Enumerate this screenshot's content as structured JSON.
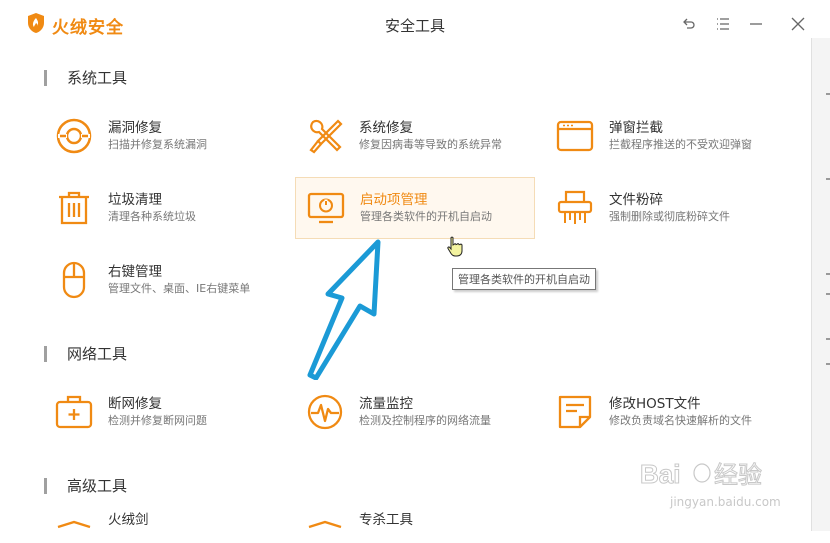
{
  "app": {
    "brand": "火绒安全",
    "window_title": "安全工具"
  },
  "sections": [
    {
      "title": "系统工具"
    },
    {
      "title": "网络工具"
    },
    {
      "title": "高级工具"
    }
  ],
  "tools": {
    "loophole": {
      "name": "漏洞修复",
      "desc": "扫描并修复系统漏洞"
    },
    "sysrepair": {
      "name": "系统修复",
      "desc": "修复因病毒等导致的系统异常"
    },
    "popup": {
      "name": "弹窗拦截",
      "desc": "拦截程序推送的不受欢迎弹窗"
    },
    "cleanup": {
      "name": "垃圾清理",
      "desc": "清理各种系统垃圾"
    },
    "startup": {
      "name": "启动项管理",
      "desc": "管理各类软件的开机自启动"
    },
    "shredder": {
      "name": "文件粉碎",
      "desc": "强制删除或彻底粉碎文件"
    },
    "rightclick": {
      "name": "右键管理",
      "desc": "管理文件、桌面、IE右键菜单"
    },
    "netrepair": {
      "name": "断网修复",
      "desc": "检测并修复断网问题"
    },
    "traffic": {
      "name": "流量监控",
      "desc": "检测及控制程序的网络流量"
    },
    "host": {
      "name": "修改HOST文件",
      "desc": "修改负责域名快速解析的文件"
    },
    "adv1": {
      "name": "火绒剑"
    },
    "adv2": {
      "name": "专杀工具"
    }
  },
  "tooltip": "管理各类软件的开机自启动",
  "watermark": {
    "brand": "Baidu经验",
    "url": "jingyan.baidu.com"
  },
  "colors": {
    "accent": "#f08a13",
    "arrow": "#1b9ad6"
  }
}
